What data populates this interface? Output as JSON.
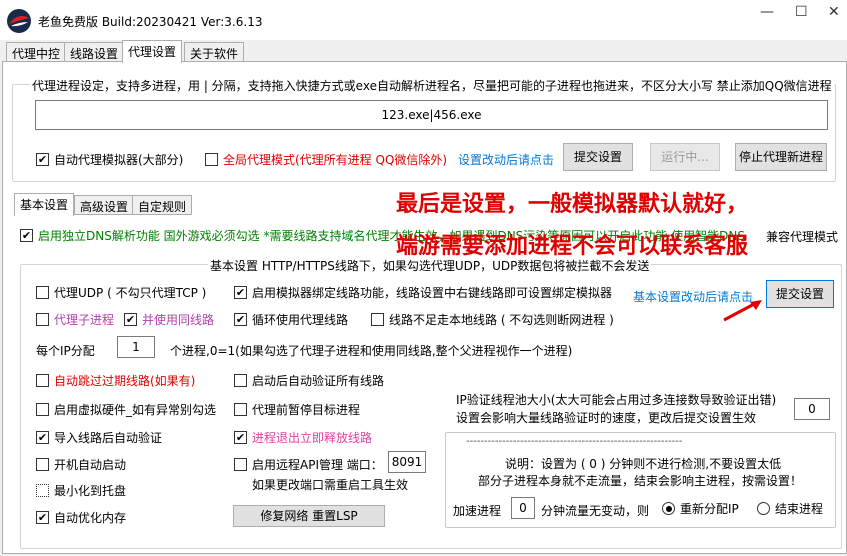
{
  "window": {
    "title": "老鱼免费版 Build:20230421 Ver:3.6.13",
    "minimize": "—",
    "maximize": "☐",
    "close": "✕"
  },
  "top_tabs": [
    "代理中控",
    "线路设置",
    "代理设置",
    "关于软件"
  ],
  "proxy_process": {
    "group_title": "代理进程设定，支持多进程，用 | 分隔，支持拖入快捷方式或exe自动解析进程名，尽量把可能的子进程也拖进来，不区分大小写 禁止添加QQ微信进程",
    "process_value": "123.exe|456.exe",
    "auto_emulator_label": "自动代理模拟器(大部分)",
    "global_mode_label": "全局代理模式(代理所有进程 QQ微信除外)",
    "hint": "设置改动后请点击",
    "submit_button": "提交设置",
    "running_button": "运行中...",
    "stop_button": "停止代理新进程"
  },
  "sub_tabs": [
    "基本设置",
    "高级设置",
    "自定规则"
  ],
  "dns_line": "启用独立DNS解析功能  国外游戏必须勾选 *需要线路支持域名代理才能生效，如果遇到DNS污染等原因可以开启此功能 使用智能DNS",
  "dns_tail": "兼容代理模式",
  "basic": {
    "group_title": "基本设置  HTTP/HTTPS线路下，如果勾选代理UDP，UDP数据包将被拦截不会发送",
    "proxy_udp": "代理UDP ( 不勾只代理TCP )",
    "bind_emulator": "启用模拟器绑定线路功能，线路设置中右键线路即可设置绑定模拟器",
    "proxy_child": "代理子进程",
    "same_line": "并使用同线路",
    "cycle_lines": "循环使用代理线路",
    "no_local": "线路不足走本地线路 ( 不勾选则断网进程 )",
    "hint": "基本设置改动后请点击",
    "submit_button": "提交设置",
    "per_ip_label": "每个IP分配",
    "per_ip_value": "1",
    "per_ip_desc": "个进程,0=1(如果勾选了代理子进程和使用同线路,整个父进程视作一个进程)",
    "skip_expired": "自动跳过过期线路(如果有)",
    "verify_on_start": "启动后自动验证所有线路",
    "virtual_hw": "启用虚拟硬件_如有异常别勾选",
    "pause_target": "代理前暂停目标进程",
    "verify_after_import": "导入线路后自动验证",
    "release_on_exit": "进程退出立即释放线路",
    "autostart": "开机自动启动",
    "remote_api": "启用远程API管理 端口：",
    "port_value": "8091",
    "port_note": "如果更改端口需重启工具生效",
    "minimize_tray": "最小化到托盘",
    "auto_optimize": "自动优化内存",
    "repair_button": "修复网络 重置LSP",
    "pool_title": "IP验证线程池大小(太大可能会占用过多连接数导致验证出错)",
    "pool_desc": "设置会影响大量线路验证时的速度，更改后提交设置生效",
    "pool_value": "0",
    "dash": "------------------------------------------------------------",
    "note1": "说明：设置为 ( 0 ) 分钟则不进行检测,不要设置太低",
    "note2": "部分子进程本身就不走流量，结束会影响主进程，按需设置！",
    "accel_label": "加速进程",
    "accel_value": "0",
    "accel_desc": "分钟流量无变动，则",
    "realloc": "重新分配IP",
    "end_proc": "结束进程"
  },
  "overlay": {
    "line1": "最后是设置，一般模拟器默认就好，",
    "line2": "端游需要添加进程不会可以联系客服"
  },
  "colors": {
    "accent": "#0078d7",
    "warning": "#e00000",
    "ok": "#008000"
  }
}
